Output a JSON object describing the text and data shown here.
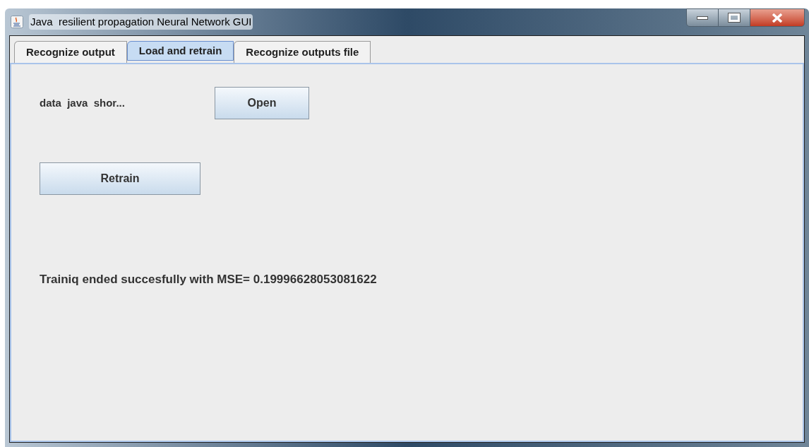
{
  "window": {
    "title": "Java  resilient propagation Neural Network GUI"
  },
  "tabs": [
    {
      "label": "Recognize output",
      "selected": false
    },
    {
      "label": "Load and retrain",
      "selected": true
    },
    {
      "label": "Recognize outputs file",
      "selected": false
    }
  ],
  "panel": {
    "file_label": "data  java  shor...",
    "open_button": "Open",
    "retrain_button": "Retrain",
    "status": "Trainiq ended succesfully with MSE= 0.19996628053081622"
  }
}
